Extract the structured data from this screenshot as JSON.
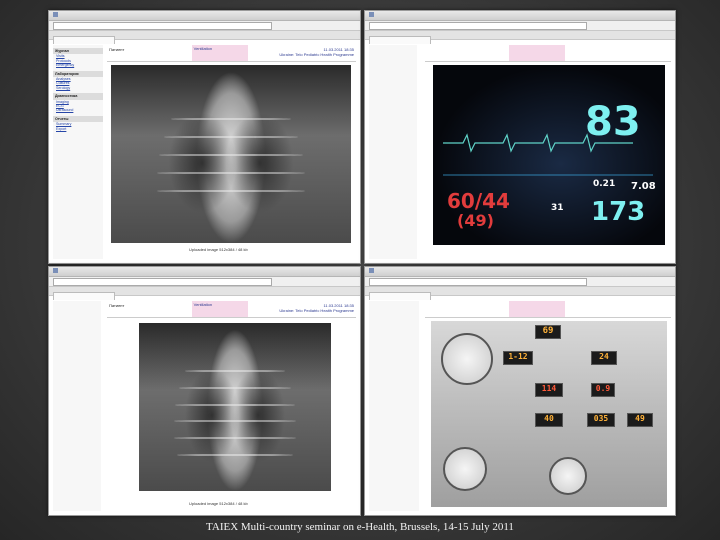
{
  "caption": "TAIEX Multi-country seminar on e-Health, Brussels, 14-15 July 2011",
  "screens": {
    "s1": {
      "sidebar": {
        "sections": [
          {
            "title": "Журнал",
            "items": [
              "Visits",
              "Protocols",
              "Emergency"
            ]
          },
          {
            "title": "Лаборатория",
            "items": [
              "Analyses",
              "Cultures",
              "Serology"
            ]
          },
          {
            "title": "Диагностика",
            "items": [
              "Imaging",
              "ECG",
              "Ultrasound"
            ]
          },
          {
            "title": "Отчеты",
            "items": [
              "Summary",
              "Export"
            ]
          }
        ]
      },
      "header": {
        "patient_label": "Патиент",
        "status": "Ventilation",
        "timestamp": "11.03.2011 18:35",
        "program": "Ukraine: Telo Pediatric Health Programme"
      },
      "footer": "Uploaded image 512x384 / 48 kb"
    },
    "s2": {
      "monitor": {
        "hr": "83",
        "bp_main": "60/44",
        "bp_mean": "(49)",
        "spo2": "173",
        "aux1": "0.21",
        "aux2": "7.08",
        "aux3": "31"
      }
    },
    "s3": {
      "header": {
        "patient_label": "Патиент",
        "status": "Ventilation",
        "timestamp": "11.03.2011 18:35",
        "program": "Ukraine: Telo Pediatric Health Programme"
      },
      "footer": "Uploaded image 512x384 / 48 kb"
    },
    "s4": {
      "ventilator": {
        "d1": "69",
        "d2": "1-12",
        "d3": "24",
        "d4": "114",
        "d5": "0.9",
        "d6": "40",
        "d7": "035",
        "d8": "49"
      }
    }
  }
}
